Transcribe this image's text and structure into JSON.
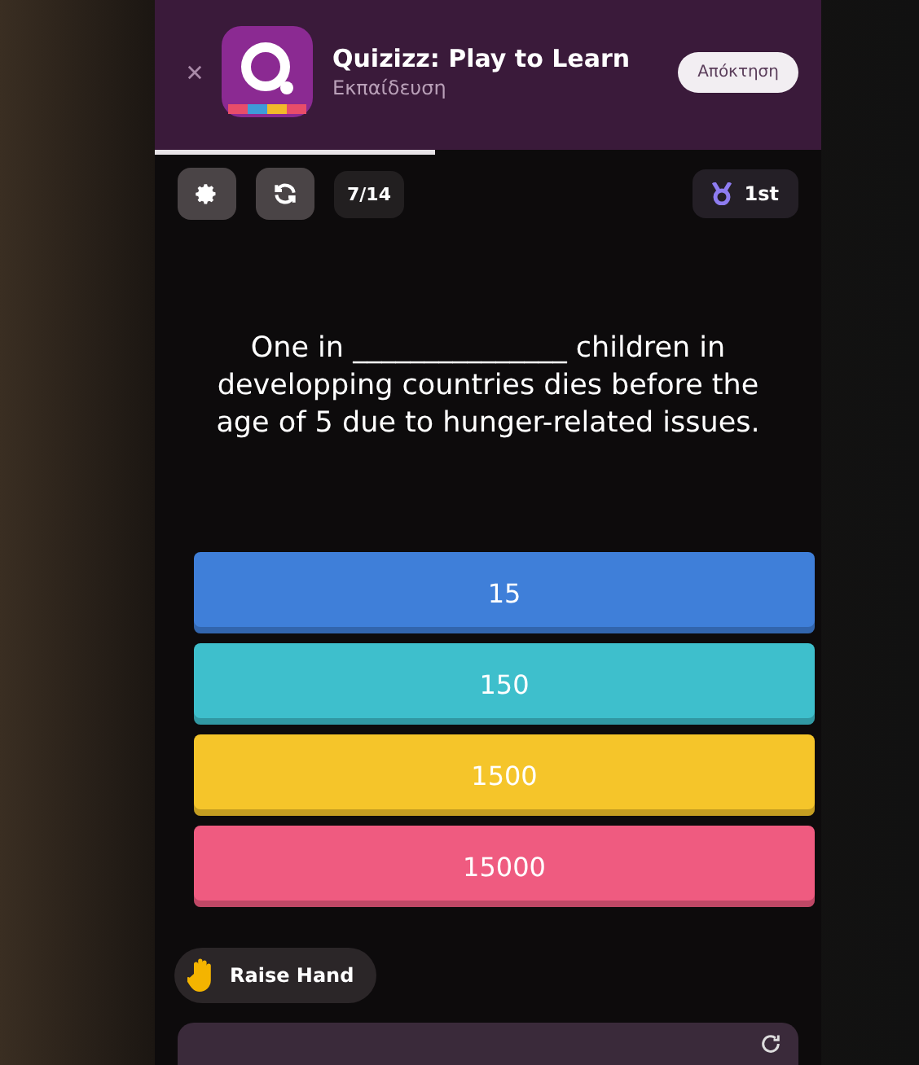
{
  "app_banner": {
    "title": "Quizizz: Play to Learn",
    "category": "Εκπαίδευση",
    "get_button": "Απόκτηση"
  },
  "load_progress": {
    "level": 0.42
  },
  "toolbar": {
    "counter": "7/14",
    "rank": "1st"
  },
  "question": {
    "text": "One in _______________ children in developping countries dies before the age of 5 due to hunger-related issues."
  },
  "answers": [
    {
      "label": "15",
      "color": "#3f7fd9"
    },
    {
      "label": "150",
      "color": "#3ebfcc"
    },
    {
      "label": "1500",
      "color": "#f5c52a"
    },
    {
      "label": "15000",
      "color": "#ef5b80"
    }
  ],
  "raise_hand": {
    "label": "Raise Hand"
  }
}
